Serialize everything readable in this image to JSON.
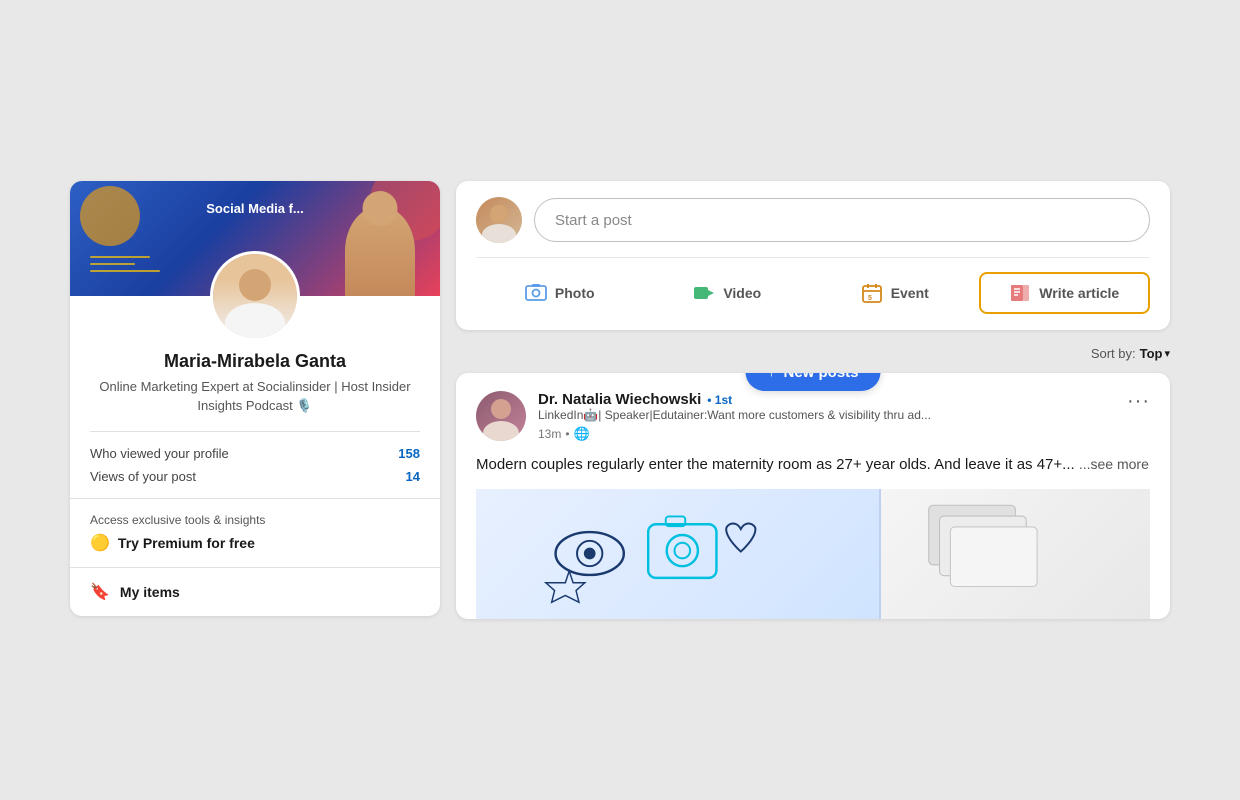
{
  "page": {
    "background": "#e8e8e8"
  },
  "left_panel": {
    "banner": {
      "text": "Social Media f..."
    },
    "profile": {
      "name": "Maria-Mirabela Ganta",
      "title": "Online Marketing Expert at Socialinsider | Host Insider Insights Podcast 🎙️",
      "avatar_alt": "Profile photo"
    },
    "stats": {
      "who_viewed_label": "Who viewed your profile",
      "who_viewed_value": "158",
      "views_post_label": "Views of your post",
      "views_post_value": "14"
    },
    "premium": {
      "label": "Access exclusive tools & insights",
      "cta": "Try Premium for free",
      "gem_icon": "🟡"
    },
    "my_items": {
      "label": "My items"
    }
  },
  "right_panel": {
    "composer": {
      "placeholder": "Start a post",
      "actions": {
        "photo": "Photo",
        "video": "Video",
        "event": "Event",
        "write_article": "Write article"
      }
    },
    "sort": {
      "label": "Sort by:",
      "value": "Top"
    },
    "new_posts_btn": "↑ New posts",
    "post": {
      "author": {
        "name": "Dr. Natalia Wiechowski",
        "connection": "• 1st",
        "description": "LinkedIn🤖| Speaker|Edutainer:Want more customers & visibility thru ad...",
        "time": "13m",
        "visibility": "🌐"
      },
      "text": "Modern couples regularly enter the maternity room as 27+ year olds. And leave it as 47+...",
      "see_more": "...see more",
      "more_options": "···"
    }
  }
}
